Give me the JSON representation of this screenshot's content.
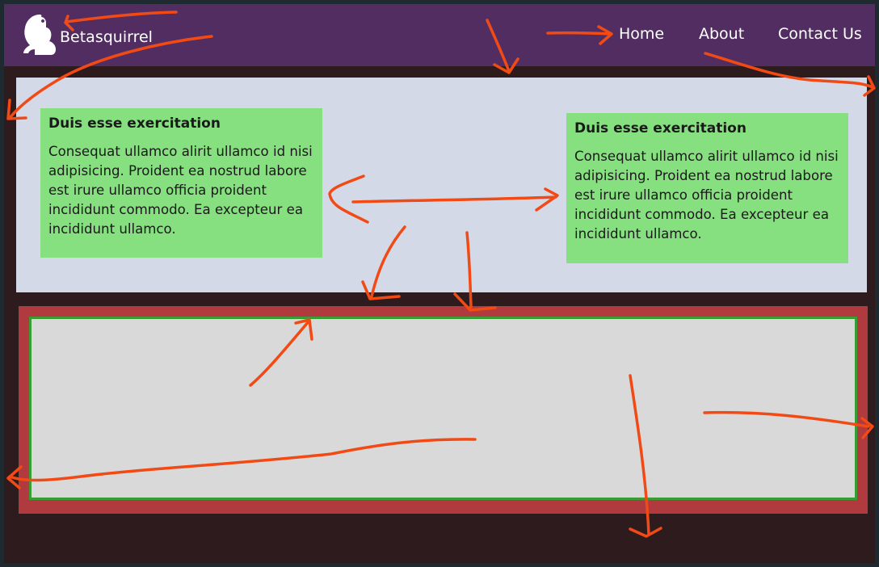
{
  "navbar": {
    "brand": "Betasquirrel",
    "links": [
      "Home",
      "About",
      "Contact Us"
    ]
  },
  "cards": [
    {
      "title": "Duis esse exercitation",
      "body": "Consequat ullamco alirit ullamco id nisi adipisicing. Proident ea nostrud labore est irure ullamco officia proident incididunt commodo. Ea excepteur ea incididunt ullamco."
    },
    {
      "title": "Duis esse exercitation",
      "body": "Consequat ullamco alirit ullamco id nisi adipisicing. Proident ea nostrud labore est irure ullamco officia proident incididunt commodo. Ea excepteur ea incididunt ullamco."
    }
  ],
  "colors": {
    "navbar": "#522d61",
    "page_background": "#2d1b1e",
    "content_section": "#d4d9e8",
    "card": "#86e07f",
    "lower_outer": "#b03a3e",
    "lower_inner": "#d9d9d9",
    "lower_inner_border": "#3a9c35",
    "annotation_arrows": "#f24a15"
  },
  "icons": {
    "logo": "squirrel-logo-icon"
  }
}
